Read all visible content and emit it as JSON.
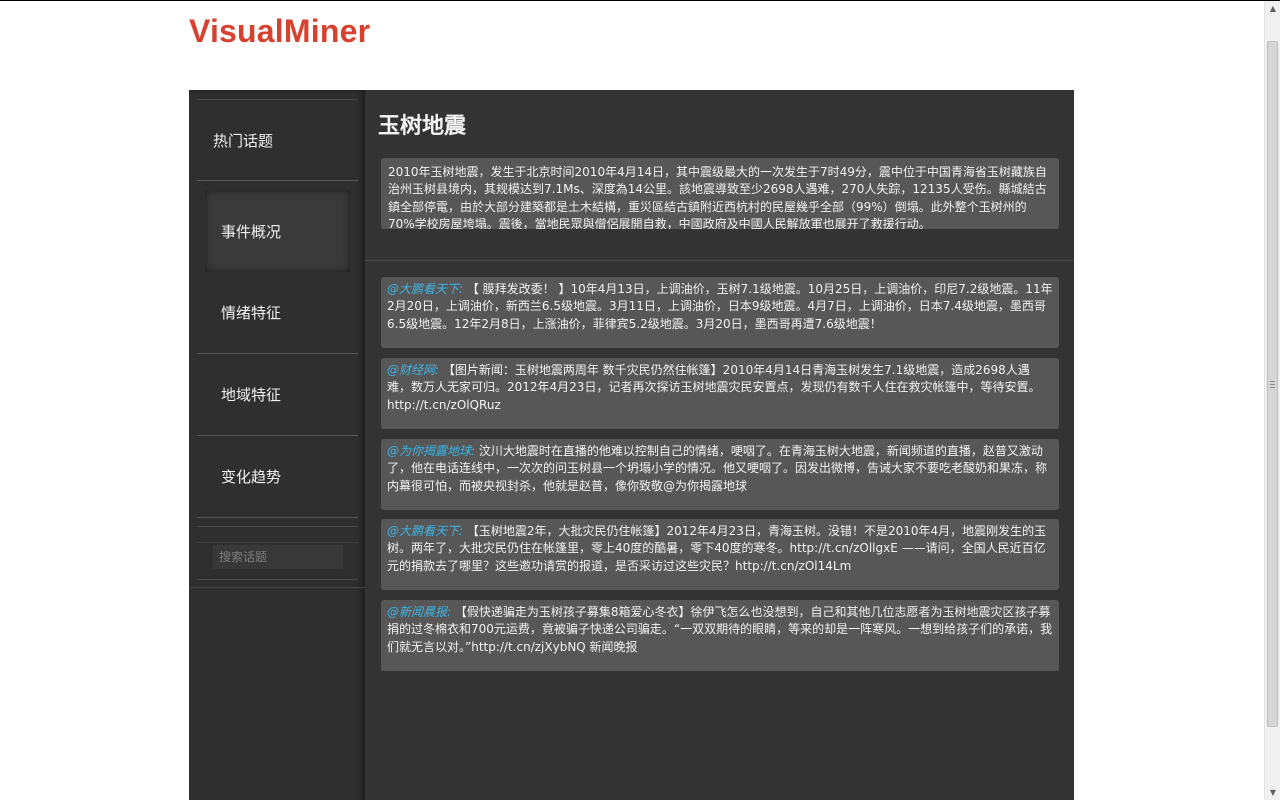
{
  "brand": {
    "name": "VisualMiner",
    "color": "#d9412f"
  },
  "sidebar": {
    "items": [
      {
        "label": "热门话题"
      },
      {
        "label": "事件概况"
      },
      {
        "label": "情绪特征"
      },
      {
        "label": "地域特征"
      },
      {
        "label": "变化趋势"
      }
    ],
    "active_item": "事件概况",
    "search": {
      "placeholder": "搜索话题",
      "value": ""
    }
  },
  "main": {
    "title": "玉树地震",
    "summary": "2010年玉树地震，发生于北京时间2010年4月14日，其中震级最大的一次发生于7时49分，震中位于中国青海省玉树藏族自治州玉树县境内，其规模达到7.1Ms、深度為14公里。該地震導致至少2698人遇难，270人失踪，12135人受伤。縣城結古鎮全部停電，由於大部分建築都是土木結構，重災區結古鎮附近西杭村的民屋幾乎全部（99%）倒塌。此外整个玉树州的70%学校房屋垮塌。震後，當地民眾與僧侶展開自救，中國政府及中國人民解放軍也展开了救援行动。",
    "posts": [
      {
        "author": "@大鹏看天下:",
        "text": " 【 膜拜发改委！ 】10年4月13日，上调油价，玉树7.1级地震。10月25日，上调油价，印尼7.2级地震。11年2月20日，上调油价，新西兰6.5级地震。3月11日，上调油价，日本9级地震。4月7日，上调油价，日本7.4级地震，墨西哥6.5级地震。12年2月8日，上涨油价，菲律宾5.2级地震。3月20日，墨西哥再遭7.6级地震！"
      },
      {
        "author": "@财经网:",
        "text": " 【图片新闻：玉树地震两周年 数千灾民仍然住帐篷】2010年4月14日青海玉树发生7.1级地震，造成2698人遇难，数万人无家可归。2012年4月23日，记者再次探访玉树地震灾民安置点，发现仍有数千人住在救灾帐篷中，等待安置。http://t.cn/zOlQRuz"
      },
      {
        "author": "@为你揭露地球:",
        "text": " 汶川大地震时在直播的他难以控制自己的情绪，哽咽了。在青海玉树大地震，新闻频道的直播，赵普又激动了，他在电话连线中，一次次的问玉树县一个坍塌小学的情况。他又哽咽了。因发出微博，告诫大家不要吃老酸奶和果冻，称内幕很可怕，而被央视封杀，他就是赵普，像你致敬@为你揭露地球"
      },
      {
        "author": "@大鹏看天下:",
        "text": " 【玉树地震2年，大批灾民仍住帐篷】2012年4月23日，青海玉树。没错！不是2010年4月，地震刚发生的玉树。两年了，大批灾民仍住在帐篷里，零上40度的酷暑，零下40度的寒冬。http://t.cn/zOllgxE ——请问，全国人民近百亿元的捐款去了哪里？这些邀功请赏的报道，是否采访过这些灾民？http://t.cn/zOl14Lm"
      },
      {
        "author": "@新闻晨报:",
        "text": " 【假快递骗走为玉树孩子募集8箱爱心冬衣】徐伊飞怎么也没想到，自己和其他几位志愿者为玉树地震灾区孩子募捐的过冬棉衣和700元运费，竟被骗子快递公司骗走。“一双双期待的眼睛，等来的却是一阵寒风。一想到给孩子们的承诺，我们就无言以对。”http://t.cn/zjXybNQ 新闻晚报"
      }
    ]
  },
  "colors": {
    "panel_bg": "#333333",
    "card_bg": "#575757",
    "author_link": "#3cb4e7"
  }
}
